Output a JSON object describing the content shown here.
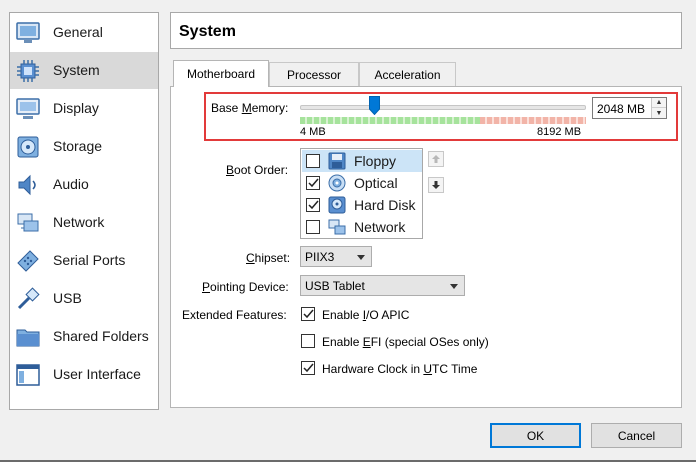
{
  "sidebar": {
    "items": [
      {
        "label": "General",
        "icon": "general-icon"
      },
      {
        "label": "System",
        "icon": "system-icon",
        "selected": true
      },
      {
        "label": "Display",
        "icon": "display-icon"
      },
      {
        "label": "Storage",
        "icon": "storage-icon"
      },
      {
        "label": "Audio",
        "icon": "audio-icon"
      },
      {
        "label": "Network",
        "icon": "network-icon"
      },
      {
        "label": "Serial Ports",
        "icon": "serial-ports-icon"
      },
      {
        "label": "USB",
        "icon": "usb-icon"
      },
      {
        "label": "Shared Folders",
        "icon": "shared-folders-icon"
      },
      {
        "label": "User Interface",
        "icon": "user-interface-icon"
      }
    ]
  },
  "page": {
    "title": "System"
  },
  "tabs": [
    {
      "label": "Motherboard",
      "active": true
    },
    {
      "label": "Processor"
    },
    {
      "label": "Acceleration"
    }
  ],
  "base_memory": {
    "label": "Base Memory:",
    "value_text": "2048 MB",
    "value_mb": 2048,
    "min_label": "4 MB",
    "max_label": "8192 MB"
  },
  "boot_order": {
    "label": "Boot Order:",
    "items": [
      {
        "label": "Floppy",
        "checked": false,
        "icon": "floppy-icon",
        "selected": true
      },
      {
        "label": "Optical",
        "checked": true,
        "icon": "optical-disc-icon"
      },
      {
        "label": "Hard Disk",
        "checked": true,
        "icon": "hard-disk-icon"
      },
      {
        "label": "Network",
        "checked": false,
        "icon": "network-icon"
      }
    ]
  },
  "chipset": {
    "label": "Chipset:",
    "value": "PIIX3"
  },
  "pointing_device": {
    "label": "Pointing Device:",
    "value": "USB Tablet"
  },
  "extended_features": {
    "label": "Extended Features:",
    "items": [
      {
        "label": "Enable I/O APIC",
        "checked": true
      },
      {
        "label": "Enable EFI (special OSes only)",
        "checked": false
      },
      {
        "label": "Hardware Clock in UTC Time",
        "checked": true
      }
    ]
  },
  "buttons": {
    "ok": "OK",
    "cancel": "Cancel"
  },
  "colors": {
    "highlight_border": "#e23a3a",
    "selection": "#cce4f7",
    "accent": "#0078d7"
  }
}
